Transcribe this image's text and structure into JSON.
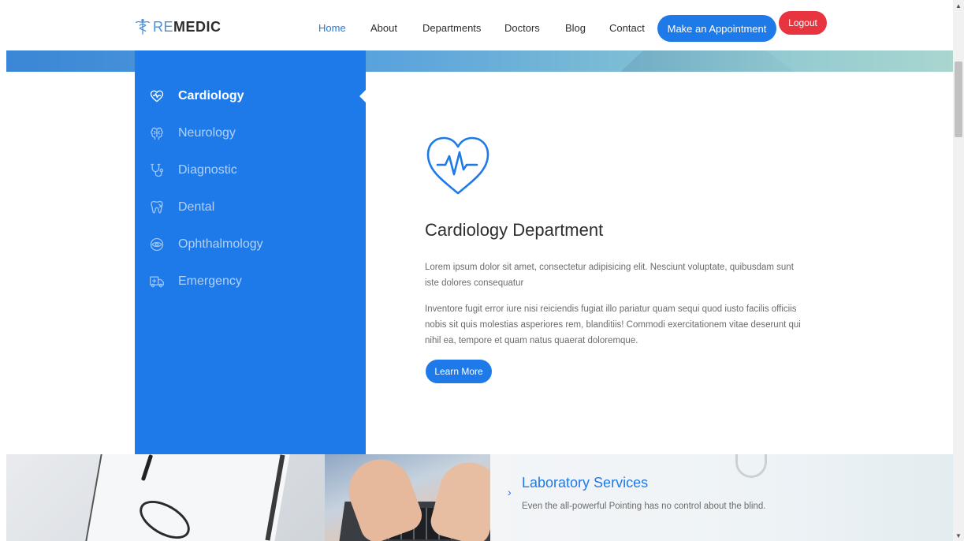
{
  "brand": {
    "prefix": "RE",
    "suffix": "MEDIC"
  },
  "nav": {
    "items": [
      {
        "label": "Home",
        "active": true
      },
      {
        "label": "About",
        "active": false
      },
      {
        "label": "Departments",
        "active": false
      },
      {
        "label": "Doctors",
        "active": false
      },
      {
        "label": "Blog",
        "active": false
      },
      {
        "label": "Contact",
        "active": false
      }
    ],
    "appointment_label": "Make an Appointment",
    "logout_label": "Logout"
  },
  "sidebar": {
    "items": [
      {
        "label": "Cardiology",
        "icon": "heart-pulse-icon",
        "active": true
      },
      {
        "label": "Neurology",
        "icon": "brain-icon",
        "active": false
      },
      {
        "label": "Diagnostic",
        "icon": "stethoscope-icon",
        "active": false
      },
      {
        "label": "Dental",
        "icon": "tooth-icon",
        "active": false
      },
      {
        "label": "Ophthalmology",
        "icon": "eye-icon",
        "active": false
      },
      {
        "label": "Emergency",
        "icon": "ambulance-icon",
        "active": false
      }
    ]
  },
  "department": {
    "icon": "heart-pulse-icon",
    "title": "Cardiology Department",
    "paragraph1": "Lorem ipsum dolor sit amet, consectetur adipisicing elit. Nesciunt voluptate, quibusdam sunt iste dolores consequatur",
    "paragraph2": "Inventore fugit error iure nisi reiciendis fugiat illo pariatur quam sequi quod iusto facilis officiis nobis sit quis molestias asperiores rem, blanditiis! Commodi exercitationem vitae deserunt qui nihil ea, tempore et quam natus quaerat doloremque.",
    "button_label": "Learn More"
  },
  "service": {
    "title": "Laboratory Services",
    "description": "Even the all-powerful Pointing has no control about the blind."
  },
  "colors": {
    "primary": "#1e7ae8",
    "logout": "#e8343f",
    "text": "#2d2d2d",
    "muted": "#6b6b6b"
  }
}
